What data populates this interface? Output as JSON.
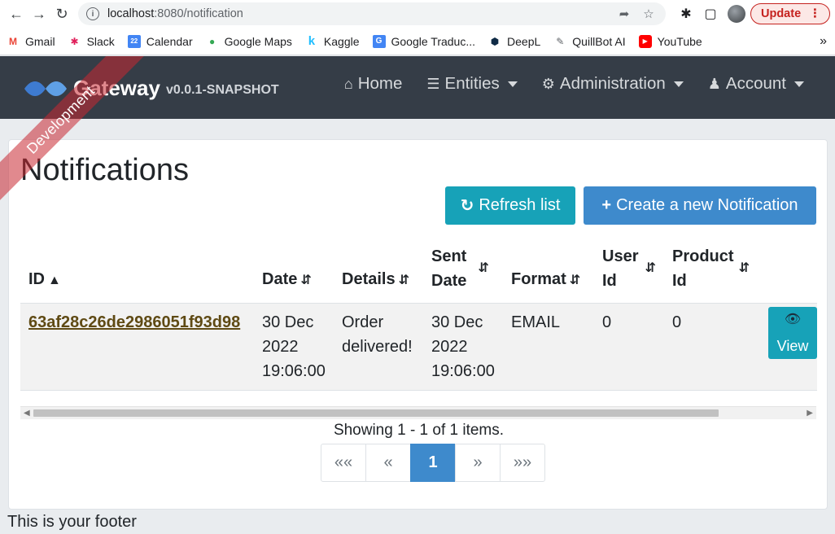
{
  "browser": {
    "url_host": "localhost",
    "url_rest": ":8080/notification",
    "update_label": "Update"
  },
  "bookmarks": [
    {
      "label": "Gmail",
      "icon": "gmail-icon",
      "color": "#ea4335",
      "glyph": "M"
    },
    {
      "label": "Slack",
      "icon": "slack-icon",
      "color": "#e01e5a",
      "glyph": "✱"
    },
    {
      "label": "Calendar",
      "icon": "calendar-icon",
      "color": "#4285f4",
      "glyph": "22"
    },
    {
      "label": "Google Maps",
      "icon": "maps-icon",
      "color": "#34a853",
      "glyph": "⬤"
    },
    {
      "label": "Kaggle",
      "icon": "kaggle-icon",
      "color": "#20beff",
      "glyph": "k"
    },
    {
      "label": "Google Traduc...",
      "icon": "translate-icon",
      "color": "#4285f4",
      "glyph": "G"
    },
    {
      "label": "DeepL",
      "icon": "deepl-icon",
      "color": "#0f2b46",
      "glyph": "⬢"
    },
    {
      "label": "QuillBot AI",
      "icon": "quillbot-icon",
      "color": "#5f6368",
      "glyph": "✎"
    },
    {
      "label": "YouTube",
      "icon": "youtube-icon",
      "color": "#ff0000",
      "glyph": "▶"
    }
  ],
  "navbar": {
    "title": "Gateway",
    "version": "v0.0.1-SNAPSHOT",
    "home": "Home",
    "entities": "Entities",
    "administration": "Administration",
    "account": "Account"
  },
  "ribbon": "Development",
  "page": {
    "title": "Notifications",
    "refresh_label": "Refresh list",
    "create_label": "Create a new Notification"
  },
  "table": {
    "headers": {
      "id": "ID",
      "date": "Date",
      "details": "Details",
      "sent_date_1": "Sent",
      "sent_date_2": "Date",
      "format": "Format",
      "user_id_1": "User",
      "user_id_2": "Id",
      "product_id_1": "Product",
      "product_id_2": "Id"
    },
    "row": {
      "id": "63af28c26de2986051f93d98",
      "date_1": "30 Dec",
      "date_2": "2022",
      "date_3": "19:06:00",
      "details_1": "Order",
      "details_2": "delivered!",
      "sent_1": "30 Dec",
      "sent_2": "2022",
      "sent_3": "19:06:00",
      "format": "EMAIL",
      "user_id": "0",
      "product_id": "0",
      "view_label": "View"
    }
  },
  "pagination": {
    "showing": "Showing 1 - 1 of 1 items.",
    "first": "««",
    "prev": "«",
    "current": "1",
    "next": "»",
    "last": "»»"
  },
  "footer": "This is your footer",
  "colors": {
    "navbar_bg": "#353d47",
    "info": "#17a2b8",
    "primary": "#3e8acc"
  }
}
